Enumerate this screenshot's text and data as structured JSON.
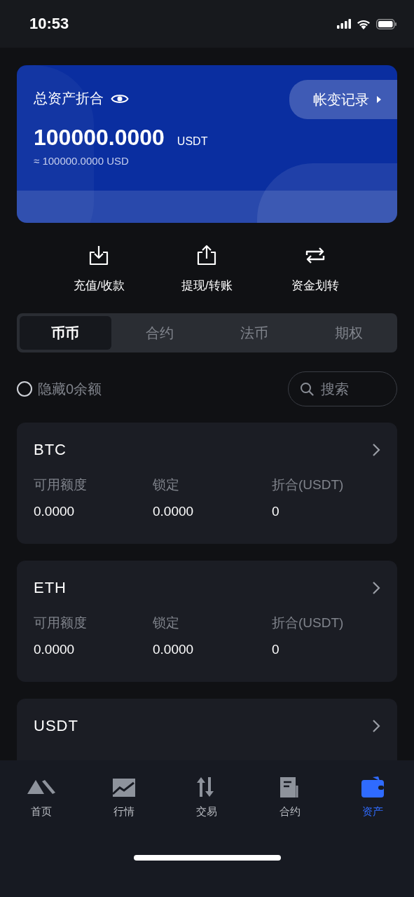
{
  "status_bar": {
    "time": "10:53"
  },
  "balance_card": {
    "title": "总资产折合",
    "history_button": "帐变记录",
    "amount": "100000.0000",
    "unit": "USDT",
    "equivalent": "≈ 100000.0000 USD"
  },
  "actions": [
    {
      "label": "充值/收款"
    },
    {
      "label": "提现/转账"
    },
    {
      "label": "资金划转"
    }
  ],
  "tabs": [
    {
      "label": "币币",
      "selected": true
    },
    {
      "label": "合约",
      "selected": false
    },
    {
      "label": "法币",
      "selected": false
    },
    {
      "label": "期权",
      "selected": false
    }
  ],
  "hide_zero": {
    "label": "隐藏0余额",
    "checked": false
  },
  "search": {
    "placeholder": "搜索"
  },
  "assets": [
    {
      "name": "BTC",
      "fields": [
        {
          "label": "可用额度",
          "value": "0.0000"
        },
        {
          "label": "锁定",
          "value": "0.0000"
        },
        {
          "label": "折合(USDT)",
          "value": "0"
        }
      ]
    },
    {
      "name": "ETH",
      "fields": [
        {
          "label": "可用额度",
          "value": "0.0000"
        },
        {
          "label": "锁定",
          "value": "0.0000"
        },
        {
          "label": "折合(USDT)",
          "value": "0"
        }
      ]
    },
    {
      "name": "USDT"
    }
  ],
  "bottom_nav": [
    {
      "label": "首页",
      "selected": false
    },
    {
      "label": "行情",
      "selected": false
    },
    {
      "label": "交易",
      "selected": false
    },
    {
      "label": "合约",
      "selected": false
    },
    {
      "label": "资产",
      "selected": true
    }
  ]
}
